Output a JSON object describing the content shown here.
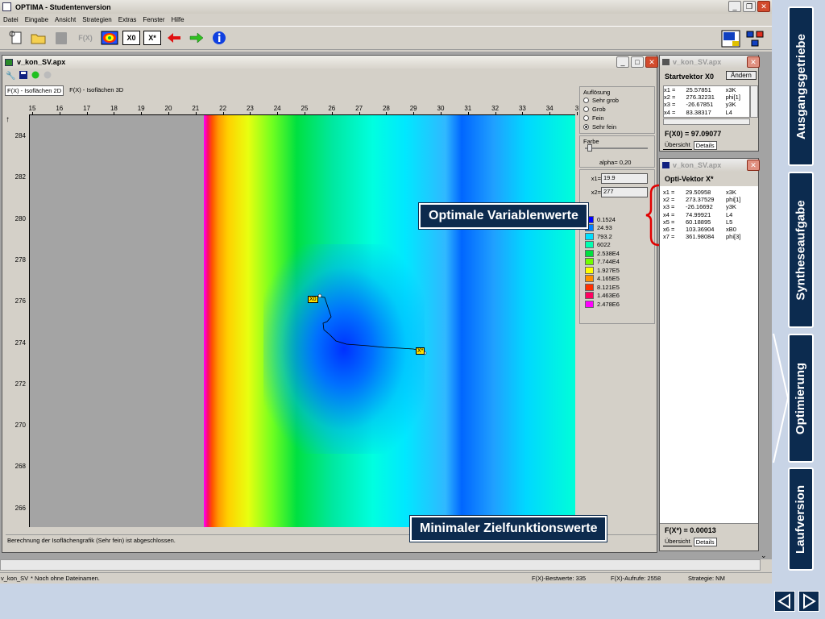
{
  "app": {
    "title": "OPTIMA - Studentenversion",
    "menu": [
      "Datei",
      "Eingabe",
      "Ansicht",
      "Strategien",
      "Extras",
      "Fenster",
      "Hilfe"
    ],
    "toolbar": {
      "fx_label": "F(X)",
      "x0_label": "X0",
      "xstar_label": "X*"
    }
  },
  "main_window": {
    "title": "v_kon_SV.apx",
    "tabs": [
      "F(X) - Isoflächen 2D",
      "F(X) - Isoflächen 3D"
    ],
    "status_message": "Berechnung der Isoflächengrafik (Sehr fein) ist abgeschlossen."
  },
  "plot": {
    "x_ticks": [
      "15",
      "16",
      "17",
      "18",
      "19",
      "20",
      "21",
      "22",
      "23",
      "24",
      "25",
      "26",
      "27",
      "28",
      "29",
      "30",
      "31",
      "32",
      "33",
      "34",
      "3"
    ],
    "y_ticks": [
      "284",
      "282",
      "280",
      "278",
      "276",
      "274",
      "272",
      "270",
      "268",
      "266"
    ],
    "x_axis_label": "x1",
    "y_axis_label": "x2",
    "marker_start": "X0",
    "marker_end": "X*"
  },
  "controls": {
    "resolution_label": "Auflösung",
    "resolution_options": [
      "Sehr grob",
      "Grob",
      "Fein",
      "Sehr fein"
    ],
    "resolution_selected": "Sehr fein",
    "color_label": "Farbe",
    "alpha_label": "alpha= 0,20",
    "x1_label": "x1=",
    "x1_value": "19.9",
    "x2_label": "x2=",
    "x2_value": "277",
    "legend": [
      {
        "value": "0.1524",
        "color": "#0000ff"
      },
      {
        "value": "24.93",
        "color": "#0080ff"
      },
      {
        "value": "793.2",
        "color": "#00e0ff"
      },
      {
        "value": "6022",
        "color": "#00ffb0"
      },
      {
        "value": "2.538E4",
        "color": "#00e040"
      },
      {
        "value": "7.744E4",
        "color": "#70ff00"
      },
      {
        "value": "1.927E5",
        "color": "#ffff00"
      },
      {
        "value": "4.165E5",
        "color": "#ff9000"
      },
      {
        "value": "8.121E5",
        "color": "#ff3000"
      },
      {
        "value": "1.463E6",
        "color": "#ff0060"
      },
      {
        "value": "2.478E6",
        "color": "#ff00ff"
      }
    ]
  },
  "start_vector": {
    "window_title": "v_kon_SV.apx",
    "heading": "Startvektor X0",
    "change_button": "Ändern",
    "rows": [
      {
        "name": "x1 =",
        "value": "25.57851",
        "unit": "x3K"
      },
      {
        "name": "x2 =",
        "value": "276.32231",
        "unit": "phi[1]"
      },
      {
        "name": "x3 =",
        "value": "-26.67851",
        "unit": "y3K"
      },
      {
        "name": "x4 =",
        "value": "83.38317",
        "unit": "L4"
      }
    ],
    "fx_label": "F(X0) = 97.09077",
    "tabs": [
      "Übersicht",
      "Details"
    ]
  },
  "opti_vector": {
    "window_title": "v_kon_SV.apx",
    "heading": "Opti-Vektor X*",
    "rows": [
      {
        "name": "x1 =",
        "value": "29.50958",
        "unit": "x3K"
      },
      {
        "name": "x2 =",
        "value": "273.37529",
        "unit": "phi[1]"
      },
      {
        "name": "x3 =",
        "value": "-26.16692",
        "unit": "y3K"
      },
      {
        "name": "x4 =",
        "value": "74.99921",
        "unit": "L4"
      },
      {
        "name": "x5 =",
        "value": "60.18895",
        "unit": "L5"
      },
      {
        "name": "x6 =",
        "value": "103.36904",
        "unit": "xB0"
      },
      {
        "name": "x7 =",
        "value": "361.98084",
        "unit": "phi[3]"
      }
    ],
    "fx_label": "F(X*) = 0.00013",
    "tabs": [
      "Übersicht",
      "Details"
    ]
  },
  "status_bar": {
    "file": "v_kon_SV",
    "note": "* Noch ohne Dateinamen.",
    "best_values": "F(X)-Bestwerte: 335",
    "calls": "F(X)-Aufrufe: 2558",
    "strategy": "Strategie: NM"
  },
  "callouts": {
    "variables": "Optimale Variablenwerte",
    "objective": "Minimaler Zielfunktionswerte"
  },
  "nav_tabs": [
    "Ausgangsgetriebe",
    "Syntheseaufgabe",
    "Optimierung",
    "Laufversion"
  ]
}
